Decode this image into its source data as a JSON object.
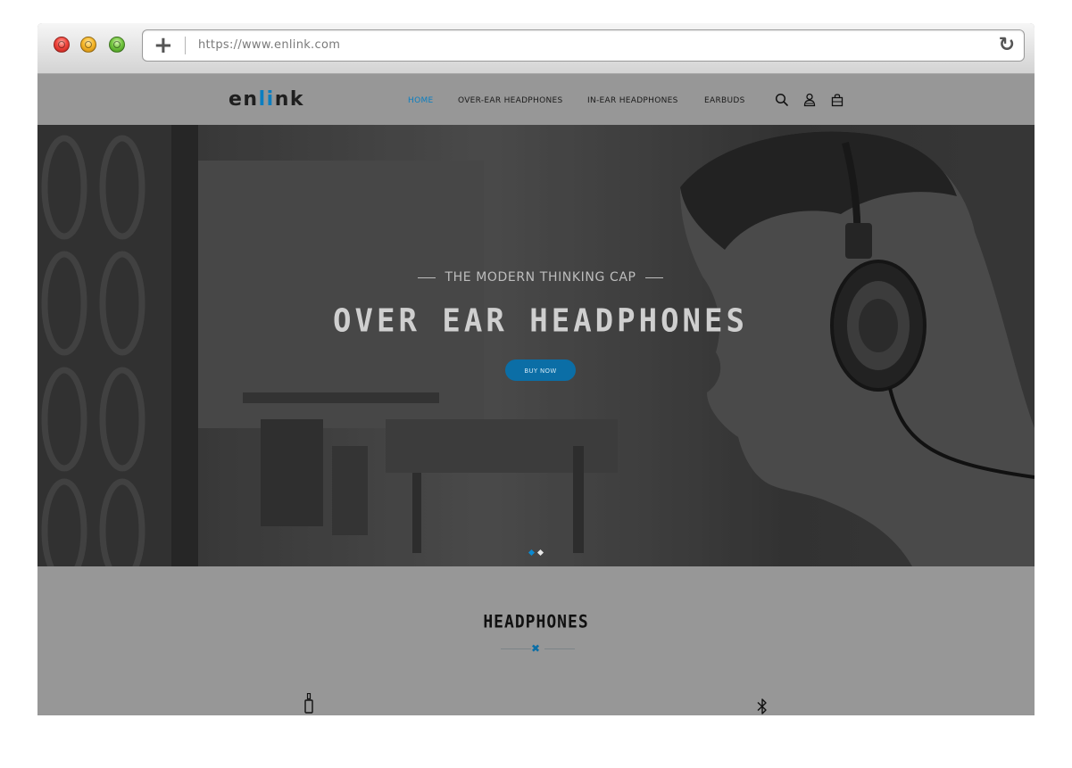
{
  "browser": {
    "url": "https://www.enlink.com",
    "new_tab_icon": "plus-icon",
    "reload_icon": "reload-icon",
    "new_tab_glyph": "+",
    "reload_glyph": "↻"
  },
  "nav": {
    "logo_prefix": "en",
    "logo_accent": "li",
    "logo_suffix": "nk",
    "items": [
      {
        "label": "HOME",
        "active": true
      },
      {
        "label": "OVER-EAR HEADPHONES",
        "active": false
      },
      {
        "label": "IN-EAR HEADPHONES",
        "active": false
      },
      {
        "label": "EARBUDS",
        "active": false
      }
    ],
    "icons": [
      "search-icon",
      "user-icon",
      "shopping-bag-icon"
    ]
  },
  "hero": {
    "subtitle": "THE MODERN THINKING CAP",
    "title": "OVER EAR HEADPHONES",
    "button_label": "BUY NOW",
    "slides_total": 2,
    "active_slide": 1
  },
  "section": {
    "title": "HEADPHONES",
    "separator_icon": "close-icon",
    "feature_icons": [
      "audio-jack-icon",
      "bluetooth-icon"
    ]
  },
  "colors": {
    "accent": "#0b7ec0",
    "button": "#0b6ea6",
    "background": "#979797"
  }
}
